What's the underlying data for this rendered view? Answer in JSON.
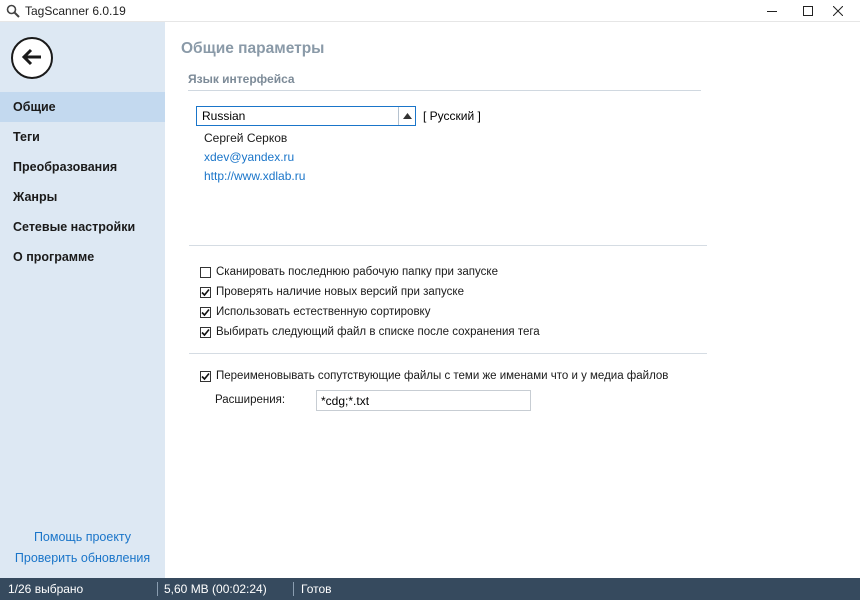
{
  "window": {
    "title": "TagScanner 6.0.19",
    "icon": "magnifier-icon",
    "controls": [
      "minimize-icon",
      "maximize-icon",
      "close-icon"
    ]
  },
  "sidebar": {
    "back_icon": "arrow-left-icon",
    "items": [
      {
        "label": "Общие",
        "active": true
      },
      {
        "label": "Теги",
        "active": false
      },
      {
        "label": "Преобразования",
        "active": false
      },
      {
        "label": "Жанры",
        "active": false
      },
      {
        "label": "Сетевые настройки",
        "active": false
      },
      {
        "label": "О программе",
        "active": false
      }
    ],
    "links": {
      "help": "Помощь проекту",
      "updates": "Проверить обновления"
    }
  },
  "main": {
    "title": "Общие параметры",
    "language_section": {
      "title": "Язык интерфейса",
      "selected_language": "Russian",
      "native_name": "[ Русский ]",
      "translator": "Сергей Серков",
      "email": "xdev@yandex.ru",
      "website": "http://www.xdlab.ru"
    },
    "options": [
      {
        "label": "Сканировать последнюю рабочую папку при запуске",
        "checked": false
      },
      {
        "label": "Проверять наличие новых версий при запуске",
        "checked": true
      },
      {
        "label": "Использовать естественную сортировку",
        "checked": true
      },
      {
        "label": "Выбирать следующий файл в списке после сохранения тега",
        "checked": true
      }
    ],
    "rename_option": {
      "label": "Переименовывать сопутствующие файлы с теми же именами что и у медиа файлов",
      "checked": true
    },
    "extensions": {
      "label": "Расширения:",
      "value": "*cdg;*.txt"
    }
  },
  "status_bar": {
    "selection": "1/26 выбрано",
    "size": "5,60 MB (00:02:24)",
    "state": "Готов"
  },
  "colors": {
    "sidebar_bg": "#dde8f3",
    "sidebar_active": "#c3d9ef",
    "status_bar_bg": "#364a5e",
    "link": "#1a75c9",
    "heading": "#8a9aa8"
  }
}
